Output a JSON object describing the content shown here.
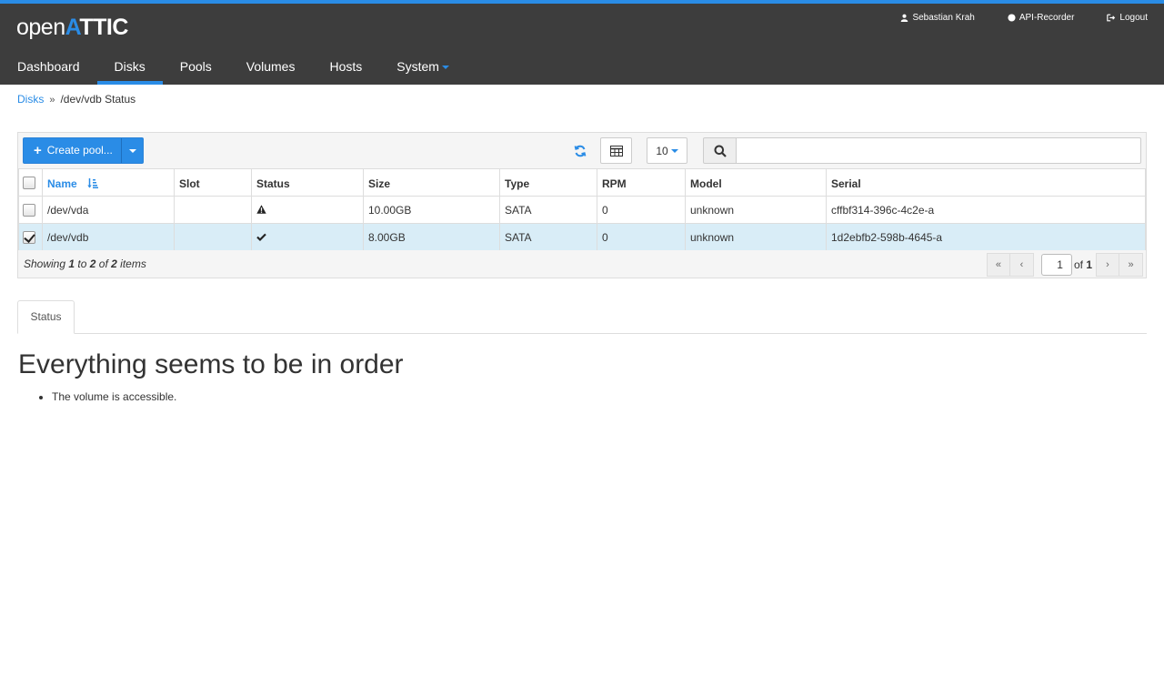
{
  "app": {
    "logo_open": "open",
    "logo_a": "A",
    "logo_ttic": "TTIC"
  },
  "user_menu": {
    "user": "Sebastian Krah",
    "api_recorder": "API-Recorder",
    "logout": "Logout"
  },
  "nav": {
    "tabs": [
      {
        "label": "Dashboard"
      },
      {
        "label": "Disks"
      },
      {
        "label": "Pools"
      },
      {
        "label": "Volumes"
      },
      {
        "label": "Hosts"
      },
      {
        "label": "System"
      }
    ],
    "active": "Disks"
  },
  "breadcrumb": {
    "parent": "Disks",
    "current": "/dev/vdb Status"
  },
  "toolbar": {
    "create_label": "Create pool...",
    "page_size": "10",
    "search_value": ""
  },
  "table": {
    "columns": [
      "Name",
      "Slot",
      "Status",
      "Size",
      "Type",
      "RPM",
      "Model",
      "Serial"
    ],
    "rows": [
      {
        "name": "/dev/vda",
        "slot": "",
        "status": "warning",
        "size": "10.00GB",
        "type": "SATA",
        "rpm": "0",
        "model": "unknown",
        "serial": "cffbf314-396c-4c2e-a",
        "selected": false
      },
      {
        "name": "/dev/vdb",
        "slot": "",
        "status": "ok",
        "size": "8.00GB",
        "type": "SATA",
        "rpm": "0",
        "model": "unknown",
        "serial": "1d2ebfb2-598b-4645-a",
        "selected": true
      }
    ]
  },
  "footer": {
    "showing_prefix": "Showing ",
    "from": "1",
    "to_word": " to ",
    "to": "2",
    "of_word": " of ",
    "total": "2",
    "items_word": " items",
    "page": "1",
    "of_label": "of",
    "pages": "1"
  },
  "details": {
    "tab_label": "Status",
    "heading": "Everything seems to be in order",
    "messages": [
      "The volume is accessible."
    ]
  },
  "colors": {
    "accent": "#2a8ce6",
    "topbar": "#3d3d3d",
    "selected_row": "#d9edf7"
  }
}
